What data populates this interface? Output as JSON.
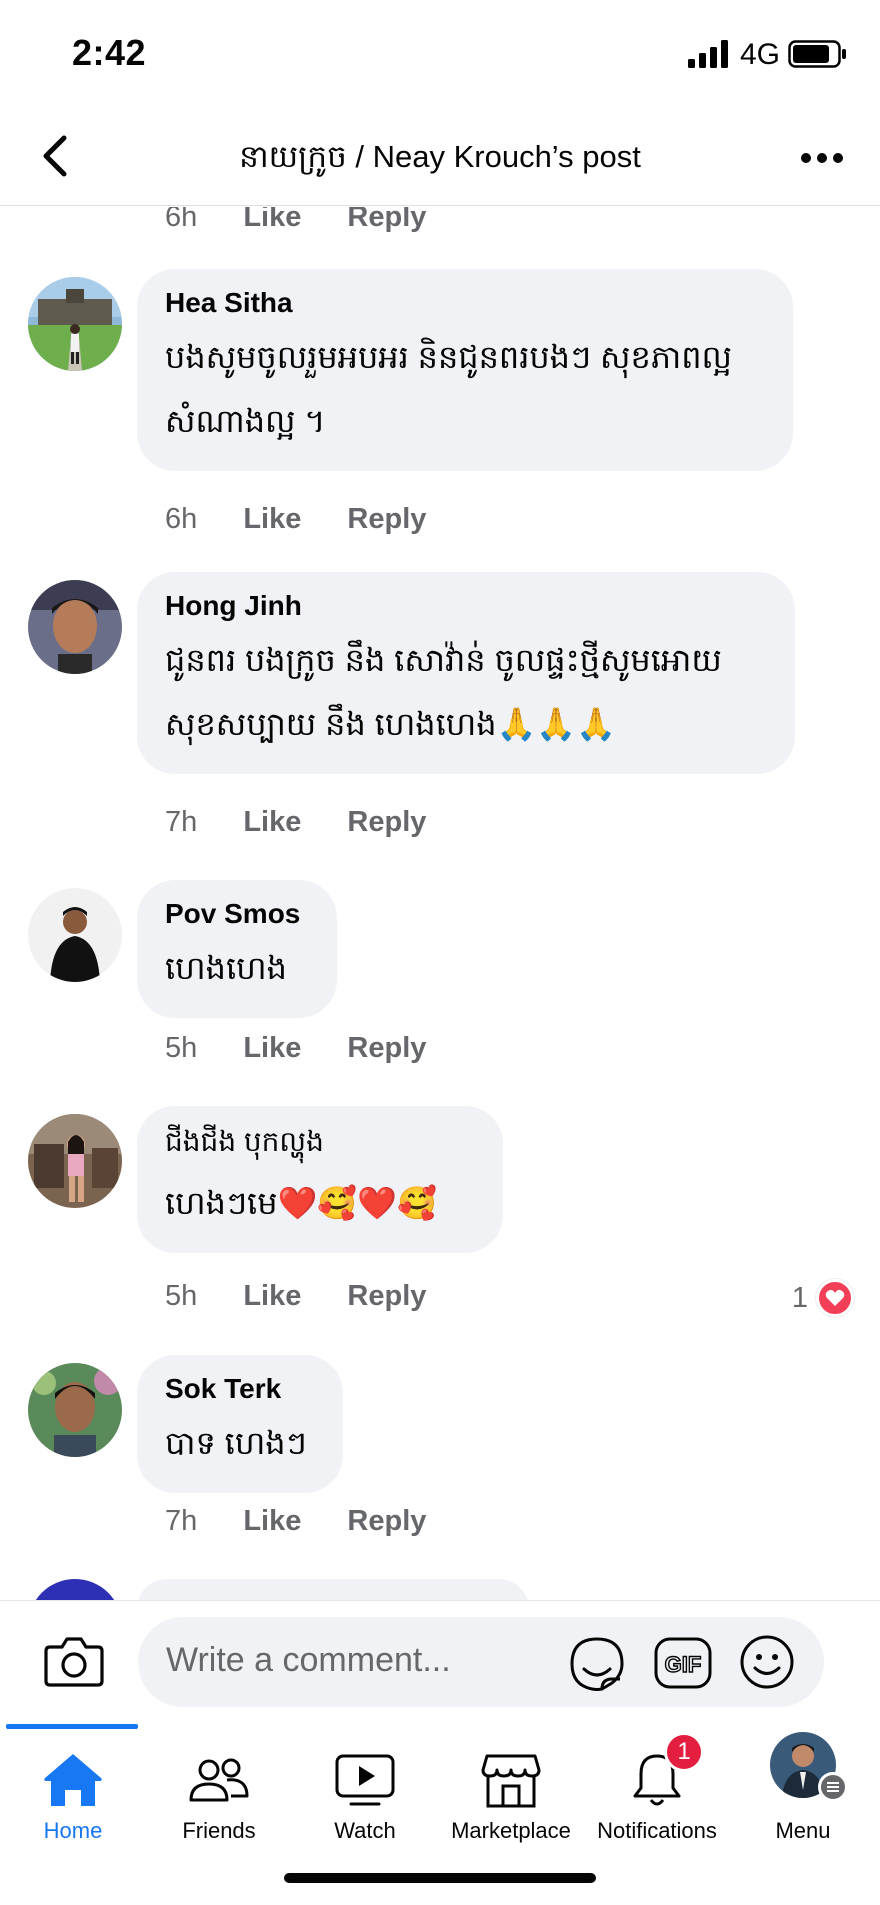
{
  "status_bar": {
    "time": "2:42",
    "network": "4G"
  },
  "header": {
    "title": "នាយក្រូច / Neay Krouch’s post"
  },
  "actions": {
    "like": "Like",
    "reply": "Reply"
  },
  "top_meta": {
    "time": "6h"
  },
  "comments": [
    {
      "author": "Hea Sitha",
      "line1": "បងសូមចូលរួមអបអរ និនជូនពរបងៗ សុខភាពល្អ",
      "line2": "សំណាងល្អ ។",
      "time": "6h"
    },
    {
      "author": "Hong Jinh",
      "line1": "ជូនពរ បងក្រូច នឹង សោវ៉ាន់ ចូលផ្ទះថ្មីសូមអោយ",
      "line2": "សុខសប្បាយ នឹង ហេងហេង🙏🙏🙏",
      "time": "7h"
    },
    {
      "author": "Pov Smos",
      "line1": "ហេងហេង",
      "time": "5h"
    },
    {
      "author": "ជីងជីង បុកល្ហុង",
      "line1": "ហេងៗមេ❤️🥰❤️🥰",
      "time": "5h",
      "reaction_count": "1"
    },
    {
      "author": "Sok Terk",
      "line1": "បាទ ហេងៗ",
      "time": "7h"
    }
  ],
  "composer": {
    "placeholder": "Write a comment...",
    "gif_label": "GIF"
  },
  "nav": {
    "home": "Home",
    "friends": "Friends",
    "watch": "Watch",
    "marketplace": "Marketplace",
    "notifications": "Notifications",
    "notifications_badge": "1",
    "menu": "Menu"
  },
  "colors": {
    "accent": "#1877f2",
    "bubble": "#f0f2f5",
    "meta": "#65676b",
    "badge": "#e41e3f",
    "heart": "#f33e58"
  }
}
